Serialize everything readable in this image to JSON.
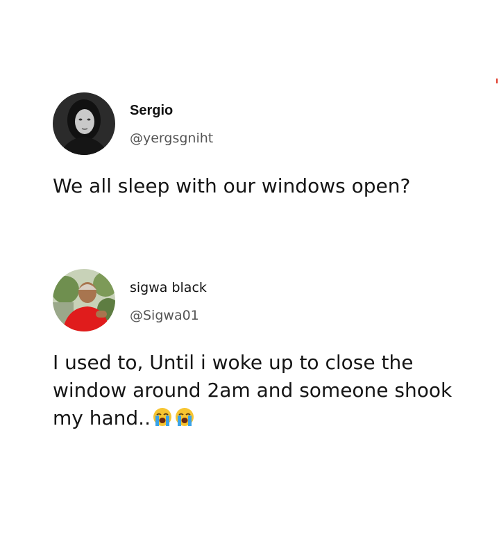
{
  "tweets": [
    {
      "display_name": "Sergio",
      "handle": "@yergsgniht",
      "text": "We all sleep with our windows open?",
      "avatar_icon": "profile-photo-woman-grayscale"
    },
    {
      "display_name": "sigwa black",
      "handle": "@Sigwa01",
      "text": "I used to, Until i woke up to close the window around 2am and someone shook my hand..",
      "emojis": [
        "loudly-crying-face-emoji",
        "loudly-crying-face-emoji"
      ],
      "avatar_icon": "profile-photo-man-red-shirt"
    }
  ],
  "colors": {
    "background": "#ffffff",
    "text": "#151515",
    "handle": "#555555"
  }
}
